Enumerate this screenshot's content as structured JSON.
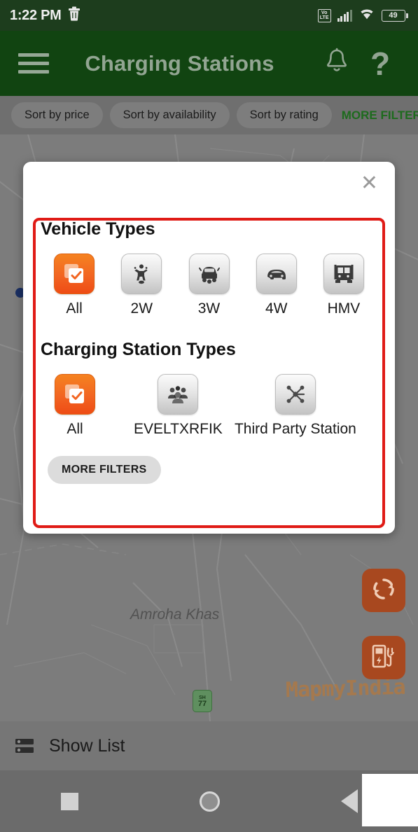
{
  "status_bar": {
    "time": "1:22 PM",
    "trash_icon": "trash-icon",
    "volte_line1": "Vo",
    "volte_line2": "LTE",
    "signal_icon": "signal-bars-icon",
    "wifi_icon": "wifi-icon",
    "battery_percent": "49"
  },
  "app_bar": {
    "menu_icon": "hamburger-menu-icon",
    "title": "Charging Stations",
    "notification_icon": "bell-icon",
    "help_icon": "?"
  },
  "filter_bar": {
    "chips": [
      {
        "label": "Sort by price"
      },
      {
        "label": "Sort by availability"
      },
      {
        "label": "Sort by rating"
      }
    ],
    "more_filters": "MORE FILTERS"
  },
  "map": {
    "place_label": "Amroha Khas",
    "highway_shield_prefix": "SH",
    "highway_shield_number": "77",
    "watermark": "MapmyIndia",
    "fab_refresh_icon": "refresh-icon",
    "fab_charger_icon": "ev-charging-station-icon"
  },
  "modal": {
    "close_icon": "✕",
    "vehicle_section": {
      "title": "Vehicle Types",
      "options": [
        {
          "label": "All",
          "icon": "checkbox-stack-icon",
          "selected": true
        },
        {
          "label": "2W",
          "icon": "motorcycle-icon",
          "selected": false
        },
        {
          "label": "3W",
          "icon": "auto-rickshaw-icon",
          "selected": false
        },
        {
          "label": "4W",
          "icon": "car-icon",
          "selected": false
        },
        {
          "label": "HMV",
          "icon": "truck-icon",
          "selected": false
        }
      ]
    },
    "station_section": {
      "title": "Charging Station Types",
      "options": [
        {
          "label": "All",
          "icon": "checkbox-stack-icon",
          "selected": true
        },
        {
          "label": "EVELTXRFIK",
          "icon": "people-group-icon",
          "selected": false
        },
        {
          "label": "Third Party Station",
          "icon": "network-hub-icon",
          "selected": false
        }
      ]
    },
    "more_filters_button": "MORE FILTERS"
  },
  "bottom_bar": {
    "show_list_icon": "list-icon",
    "show_list_label": "Show List"
  },
  "nav_bar": {
    "recents_icon": "square-recents-icon",
    "home_icon": "circle-home-icon",
    "back_icon": "triangle-back-icon"
  },
  "colors": {
    "status_bar_bg": "#1d3d1d",
    "app_bar_bg": "#114411",
    "accent_orange": "#f26522",
    "annotation_red": "#e01b16",
    "map_bg": "#7c7c7c"
  }
}
